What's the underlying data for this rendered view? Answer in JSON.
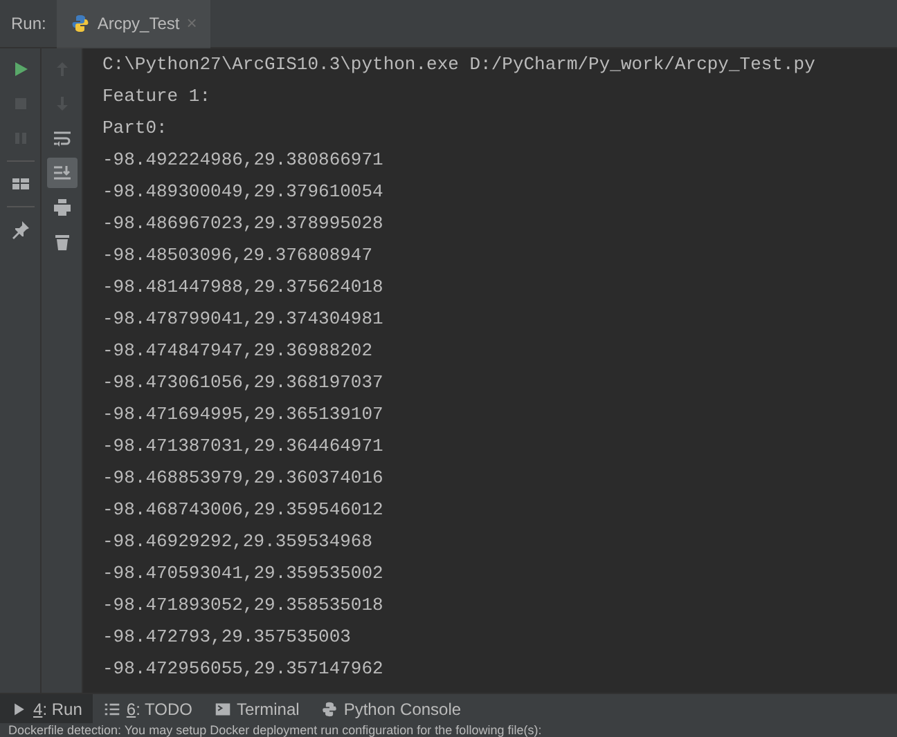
{
  "run_panel": {
    "label": "Run:",
    "tabs": [
      {
        "label": "Arcpy_Test",
        "selected": true,
        "close": "×"
      }
    ]
  },
  "left_toolbar": [
    {
      "kind": "play",
      "disabled": false
    },
    {
      "kind": "stop",
      "disabled": true
    },
    {
      "kind": "pause",
      "disabled": true
    },
    {
      "kind": "layout",
      "disabled": false
    },
    {
      "kind": "pin",
      "disabled": false
    }
  ],
  "console_toolbar": [
    {
      "kind": "up",
      "disabled": true,
      "selected": false
    },
    {
      "kind": "down",
      "disabled": true,
      "selected": false
    },
    {
      "kind": "wrap",
      "disabled": false,
      "selected": false
    },
    {
      "kind": "scroll",
      "disabled": false,
      "selected": true
    },
    {
      "kind": "print",
      "disabled": false,
      "selected": false
    },
    {
      "kind": "trash",
      "disabled": false,
      "selected": false
    }
  ],
  "console_lines": [
    "C:\\Python27\\ArcGIS10.3\\python.exe D:/PyCharm/Py_work/Arcpy_Test.py",
    "Feature 1:",
    "Part0:",
    "-98.492224986,29.380866971",
    "-98.489300049,29.379610054",
    "-98.486967023,29.378995028",
    "-98.48503096,29.376808947",
    "-98.481447988,29.375624018",
    "-98.478799041,29.374304981",
    "-98.474847947,29.36988202",
    "-98.473061056,29.368197037",
    "-98.471694995,29.365139107",
    "-98.471387031,29.364464971",
    "-98.468853979,29.360374016",
    "-98.468743006,29.359546012",
    "-98.46929292,29.359534968",
    "-98.470593041,29.359535002",
    "-98.471893052,29.358535018",
    "-98.472793,29.357535003",
    "-98.472956055,29.357147962"
  ],
  "bottom_tabs": [
    {
      "kind": "run",
      "mnemonic": "4",
      "label": ": Run",
      "selected": true
    },
    {
      "kind": "todo",
      "mnemonic": "6",
      "label": ": TODO",
      "selected": false
    },
    {
      "kind": "terminal",
      "label": "Terminal",
      "selected": false
    },
    {
      "kind": "python",
      "label": "Python Console",
      "selected": false
    }
  ],
  "status_bar": "Dockerfile detection: You may setup Docker deployment run configuration for the following file(s):"
}
